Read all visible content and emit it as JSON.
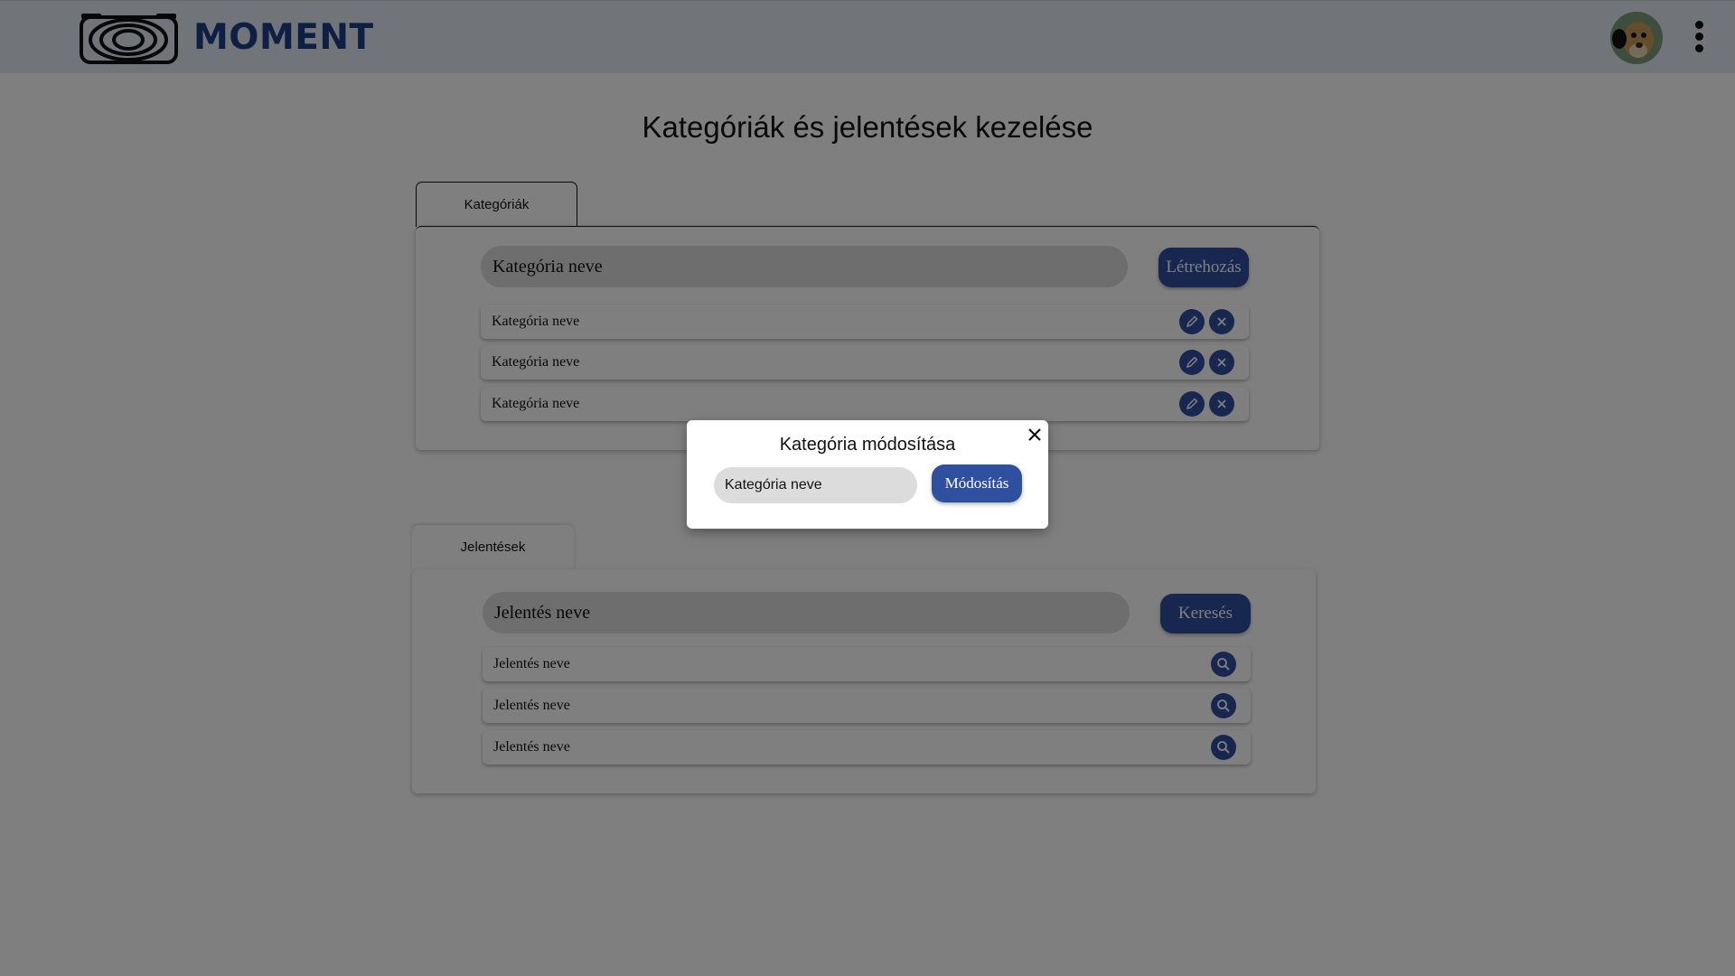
{
  "header": {
    "brand": "MOMENT",
    "logo_icon": "camera-lens-logo-icon",
    "avatar_icon": "user-avatar-icon",
    "menu_icon": "kebab-menu-icon"
  },
  "page_title": "Kategóriák és jelentések kezelése",
  "categories": {
    "tab_label": "Kategóriák",
    "input_placeholder": "Kategória neve",
    "create_label": "Létrehozás",
    "items": [
      {
        "label": "Kategória neve",
        "edit_icon": "pencil-icon",
        "delete_icon": "close-icon"
      },
      {
        "label": "Kategória neve",
        "edit_icon": "pencil-icon",
        "delete_icon": "close-icon"
      },
      {
        "label": "Kategória neve",
        "edit_icon": "pencil-icon",
        "delete_icon": "close-icon"
      }
    ]
  },
  "reports": {
    "tab_label": "Jelentések",
    "input_placeholder": "Jelentés neve",
    "search_label": "Keresés",
    "items": [
      {
        "label": "Jelentés neve",
        "view_icon": "search-icon"
      },
      {
        "label": "Jelentés neve",
        "view_icon": "search-icon"
      },
      {
        "label": "Jelentés neve",
        "view_icon": "search-icon"
      }
    ]
  },
  "modal": {
    "title": "Kategória módosítása",
    "input_value": "Kategória neve",
    "submit_label": "Módosítás",
    "close_icon": "close-icon"
  },
  "colors": {
    "primary": "#2f4f9f",
    "brand": "#1f3f86",
    "header_bg": "#e3e8f0",
    "field_bg": "#dcdcdc",
    "overlay": "rgba(0,0,0,0.5)"
  }
}
